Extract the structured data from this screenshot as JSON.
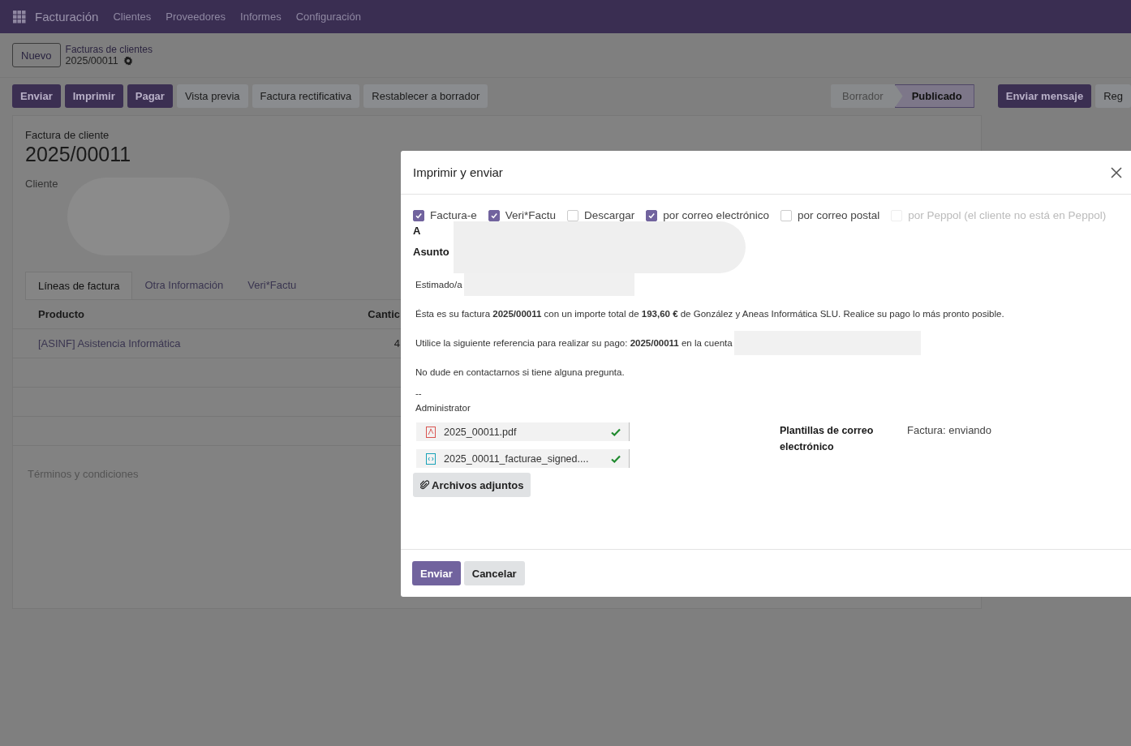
{
  "navbar": {
    "app_title": "Facturación",
    "menu": [
      "Clientes",
      "Proveedores",
      "Informes",
      "Configuración"
    ]
  },
  "breadcrumb": {
    "new_button": "Nuevo",
    "parent": "Facturas de clientes",
    "current": "2025/00011"
  },
  "action_buttons": [
    {
      "label": "Enviar",
      "kind": "primary"
    },
    {
      "label": "Imprimir",
      "kind": "primary"
    },
    {
      "label": "Pagar",
      "kind": "primary"
    },
    {
      "label": "Vista previa",
      "kind": "secondary"
    },
    {
      "label": "Factura rectificativa",
      "kind": "secondary"
    },
    {
      "label": "Restablecer a borrador",
      "kind": "secondary"
    }
  ],
  "status_steps": [
    {
      "label": "Borrador",
      "selected": false
    },
    {
      "label": "Publicado",
      "selected": true
    }
  ],
  "chatter_buttons": [
    {
      "label": "Enviar mensaje",
      "kind": "primary"
    },
    {
      "label": "Reg",
      "kind": "secondary"
    }
  ],
  "invoice": {
    "subtitle": "Factura de cliente",
    "number": "2025/00011",
    "customer_label": "Cliente",
    "tabs": [
      {
        "label": "Líneas de factura",
        "selected": true
      },
      {
        "label": "Otra Información",
        "selected": false
      },
      {
        "label": "Veri*Factu",
        "selected": false
      }
    ],
    "columns": [
      "Producto",
      "Cantic"
    ],
    "rows": [
      {
        "product": "[ASINF] Asistencia Informática",
        "column_2": "4"
      }
    ],
    "terms_placeholder": "Términos y condiciones"
  },
  "dialog": {
    "title": "Imprimir y enviar",
    "options": [
      {
        "label": "Factura-e",
        "checked": true,
        "disabled": false
      },
      {
        "label": "Veri*Factu",
        "checked": true,
        "disabled": false
      },
      {
        "label": "Descargar",
        "checked": false,
        "disabled": false
      },
      {
        "label": "por correo electrónico",
        "checked": true,
        "disabled": false
      },
      {
        "label": "por correo postal",
        "checked": false,
        "disabled": false
      },
      {
        "label": "por Peppol (el cliente no está en Peppol)",
        "checked": false,
        "disabled": true
      }
    ],
    "to_label": "A",
    "subject_label": "Asunto",
    "greeting": "Estimado/a",
    "paragraphs": [
      "Ésta es su factura **2025/00011** con un importe total de **193,60 €** de González y Aneas Informática SLU. Realice su pago lo más pronto posible.",
      "Utilice la siguiente referencia para realizar su pago: **2025/00011** en la cuenta",
      "No dude en contactarnos si tiene alguna pregunta."
    ],
    "signature_separator": "--",
    "signature": "Administrator",
    "attachments": [
      {
        "name": "2025_00011.pdf",
        "kind": "pdf",
        "uploaded": true
      },
      {
        "name": "2025_00011_facturae_signed....",
        "kind": "xml",
        "uploaded": true
      }
    ],
    "attach_button": "Archivos adjuntos",
    "templates_label": "Plantillas de correo electrónico",
    "templates_value": "Factura: enviando",
    "buttons": [
      {
        "label": "Enviar",
        "kind": "primary"
      },
      {
        "label": "Cancelar",
        "kind": "secondary"
      }
    ]
  }
}
